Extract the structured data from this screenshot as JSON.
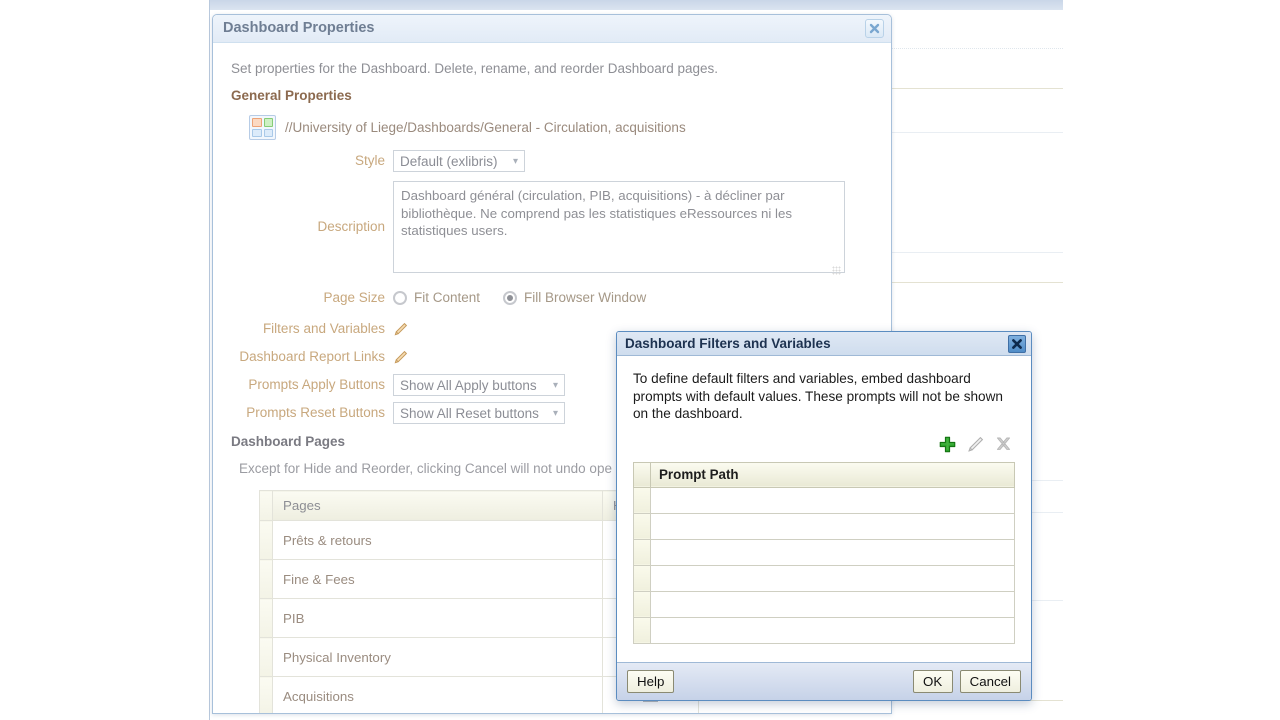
{
  "properties_dialog": {
    "title": "Dashboard Properties",
    "close_icon": "close-icon",
    "intro": "Set properties for the Dashboard. Delete, rename, and reorder Dashboard pages.",
    "general_section": "General Properties",
    "dashboard_icon": "dashboard-grid-icon",
    "dashboard_path": "//University of Liege/Dashboards/General - Circulation, acquisitions",
    "style": {
      "label": "Style",
      "value": "Default (exlibris)",
      "chevron": "chevron-down-icon"
    },
    "description": {
      "label": "Description",
      "value": "Dashboard général (circulation, PIB, acquisitions) - à décliner par bibliothèque. Ne comprend pas les statistiques eRessources ni les statistiques users."
    },
    "page_size": {
      "label": "Page Size",
      "options": [
        "Fit Content",
        "Fill Browser Window"
      ],
      "selected": "Fill Browser Window"
    },
    "filters_and_variables": {
      "label": "Filters and Variables",
      "edit_icon": "pencil-icon"
    },
    "dashboard_report_links": {
      "label": "Dashboard Report Links",
      "edit_icon": "pencil-icon"
    },
    "prompts_apply": {
      "label": "Prompts Apply Buttons",
      "value": "Show All Apply buttons",
      "chevron": "chevron-down-icon"
    },
    "prompts_reset": {
      "label": "Prompts Reset Buttons",
      "value": "Show All Reset buttons",
      "chevron": "chevron-down-icon"
    },
    "pages_section": "Dashboard Pages",
    "pages_note": "Except for Hide and Reorder, clicking Cancel will not undo ope",
    "pages_table": {
      "columns": [
        "Pages",
        "Hide Page"
      ],
      "rows": [
        {
          "name": "Prêts & retours",
          "hidden": false
        },
        {
          "name": "Fine & Fees",
          "hidden": false
        },
        {
          "name": "PIB",
          "hidden": false
        },
        {
          "name": "Physical Inventory",
          "hidden": false
        },
        {
          "name": "Acquisitions",
          "hidden": false
        }
      ]
    }
  },
  "filters_dialog": {
    "title": "Dashboard Filters and Variables",
    "close_icon": "close-icon",
    "description": "To define default filters and variables, embed dashboard prompts with default values. These prompts will not be shown on the dashboard.",
    "toolbar": {
      "add_icon": "plus-icon",
      "edit_icon": "pencil-icon",
      "delete_icon": "delete-x-icon"
    },
    "table": {
      "column": "Prompt Path",
      "row_count": 6,
      "rows": [
        "",
        "",
        "",
        "",
        "",
        ""
      ]
    },
    "footer": {
      "help_label": "Help",
      "ok_label": "OK",
      "cancel_label": "Cancel"
    }
  },
  "colors": {
    "label_gold": "#c8a87e",
    "dialog_blue_border": "#5b8cc0",
    "add_green": "#2aa02a",
    "title_blue": "#1d3250"
  }
}
